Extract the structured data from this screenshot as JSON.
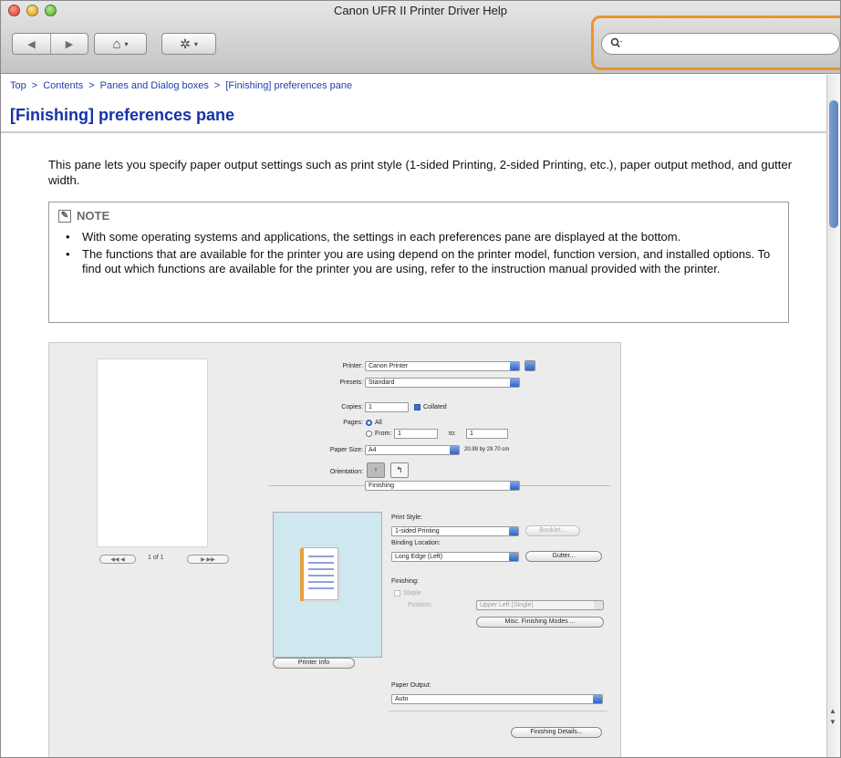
{
  "window": {
    "title": "Canon UFR II Printer Driver Help",
    "nav_back_icon": "◀",
    "nav_forward_icon": "▶",
    "home_icon": "⌂",
    "gear_icon": "✲",
    "caret": "▾",
    "search_icon": "🔍︎",
    "search_value": "",
    "search_placeholder": ""
  },
  "breadcrumb": {
    "items": [
      "Top",
      "Contents",
      "Panes and Dialog boxes",
      "[Finishing] preferences pane"
    ],
    "separator": ">"
  },
  "page": {
    "title": "[Finishing] preferences pane",
    "intro": "This pane lets you specify paper output settings such as print style (1-sided Printing, 2-sided Printing, etc.), paper output method, and gutter width.",
    "note": {
      "heading": "NOTE",
      "icon": "✎",
      "items": [
        "With some operating systems and applications, the settings in each preferences pane are displayed at the bottom.",
        "The functions that are available for the printer you are using depend on the printer model, function version, and installed options. To find out which functions are available for the printer you are using, refer to the instruction manual provided with the printer."
      ]
    }
  },
  "dialog": {
    "printer_label": "Printer:",
    "printer_value": "Canon Printer",
    "presets_label": "Presets:",
    "presets_value": "Standard",
    "copies_label": "Copies:",
    "copies_value": "1",
    "collated_label": "Collated",
    "pages_label": "Pages:",
    "pages_all": "All",
    "pages_from": "From:",
    "pages_from_value": "1",
    "pages_to": "to:",
    "pages_to_value": "1",
    "paper_size_label": "Paper Size:",
    "paper_size_value": "A4",
    "paper_size_dims": "20.99 by 29.70 cm",
    "orientation_label": "Orientation:",
    "orient_portrait": "↑",
    "orient_landscape": "↰",
    "pane_value": "Finishing",
    "page_count": "1 of 1",
    "pg_prev": "◀◀  ◀",
    "pg_next": "▶  ▶▶",
    "print_style_label": "Print Style:",
    "print_style_value": "1-sided Printing",
    "booklet_button": "Booklet...",
    "binding_label": "Binding Location:",
    "binding_value": "Long Edge (Left)",
    "gutter_button": "Gutter...",
    "finishing_label": "Finishing:",
    "staple_label": "Staple",
    "position_label": "Position:",
    "position_value": "Upper Left (Single)",
    "misc_button": "Misc. Finishing Modes ...",
    "printer_info_button": "Printer Info",
    "paper_output_label": "Paper Output:",
    "paper_output_value": "Auto",
    "finishing_details_button": "Finishing Details..."
  },
  "colors": {
    "link": "#1f3fb0",
    "title": "#1533a8",
    "search_highlight": "#e8962e"
  }
}
